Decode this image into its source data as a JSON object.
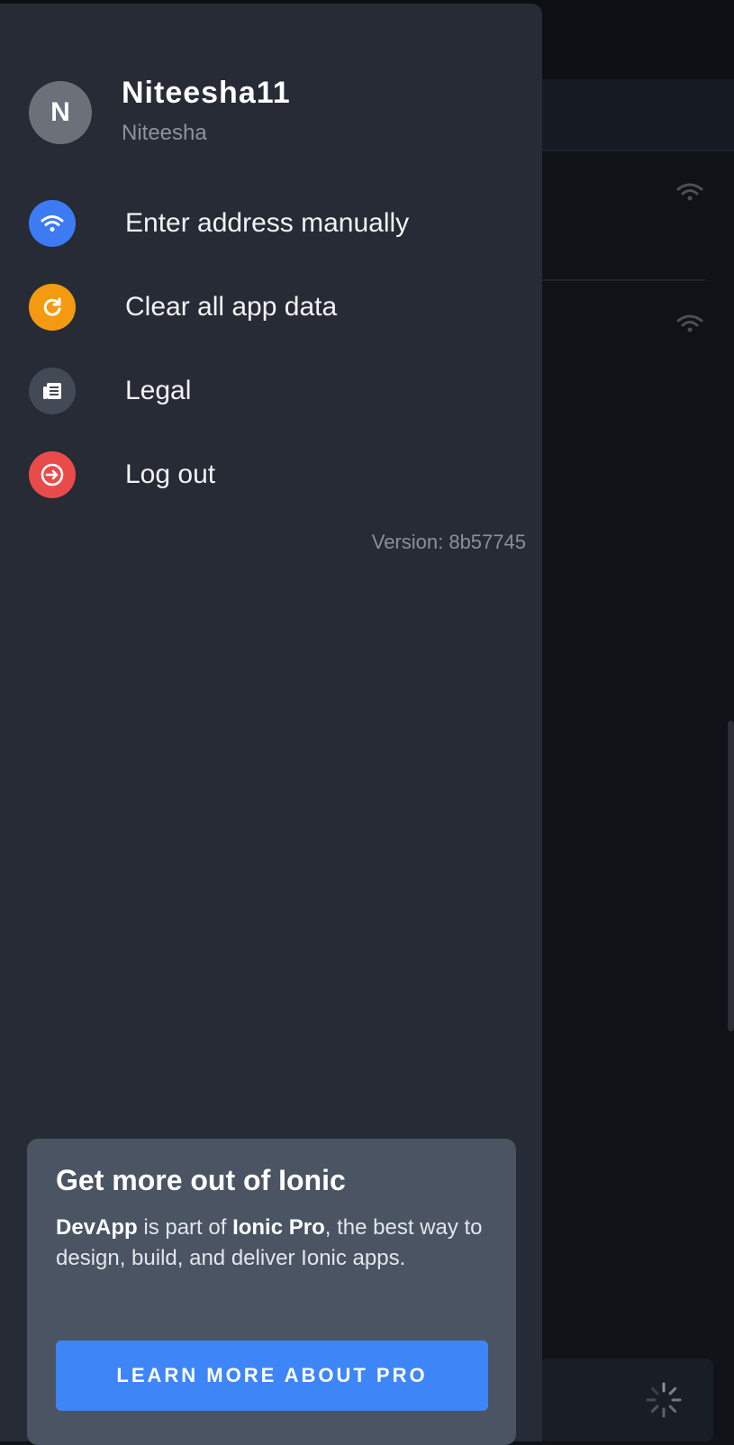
{
  "user": {
    "initial": "N",
    "username": "Niteesha11",
    "display_name": "Niteesha"
  },
  "menu": {
    "items": [
      {
        "label": "Enter address manually",
        "icon": "wifi-icon",
        "color": "#3d7bf5"
      },
      {
        "label": "Clear all app data",
        "icon": "refresh-icon",
        "color": "#f49a10"
      },
      {
        "label": "Legal",
        "icon": "document-icon",
        "color": "#434955"
      },
      {
        "label": "Log out",
        "icon": "logout-icon",
        "color": "#e94b4b"
      }
    ],
    "version": "Version: 8b57745"
  },
  "promo": {
    "title": "Get more out of Ionic",
    "text_part1": "DevApp",
    "text_part2": " is part of ",
    "text_part3": "Ionic Pro",
    "text_part4": ", the best way to design, build, and deliver Ionic apps.",
    "button_label": "LEARN MORE ABOUT PRO"
  },
  "colors": {
    "menu_bg": "#262b35",
    "promo_bg": "#4a5463",
    "primary": "#3e86f7"
  }
}
